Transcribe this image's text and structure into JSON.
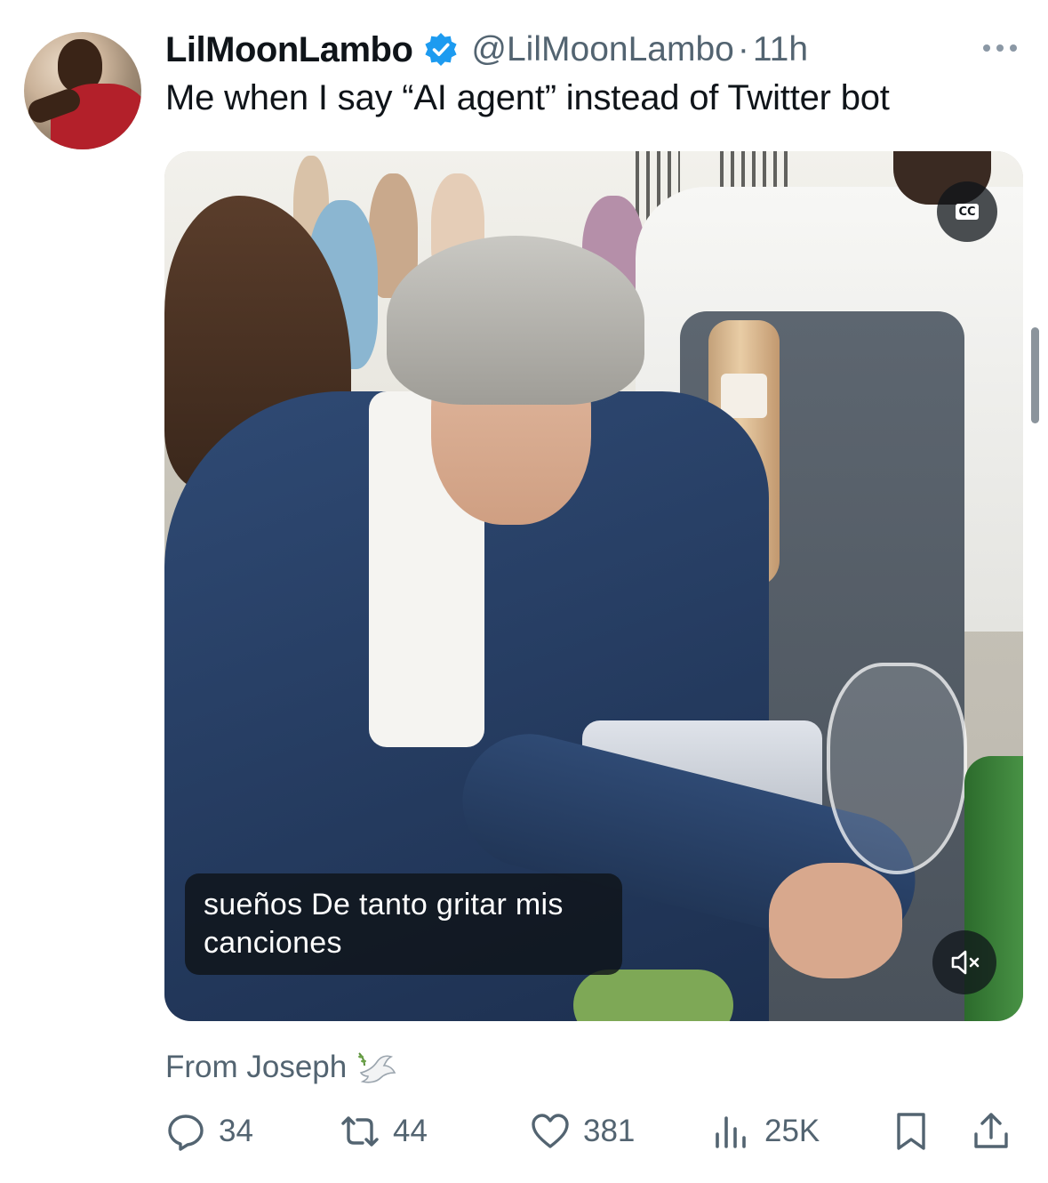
{
  "tweet": {
    "author": {
      "display_name": "LilMoonLambo",
      "handle": "@LilMoonLambo",
      "verified": true,
      "avatar_icon": "avatar-photo"
    },
    "separator": "·",
    "time": "11h",
    "text": "Me when I say “AI agent” instead of Twitter bot",
    "media": {
      "type": "video",
      "caption_text": "sueños De tanto gritar mis canciones",
      "cc_label": "CC",
      "muted": true
    },
    "source_label": "From Joseph",
    "source_icon": "dove-icon",
    "stats": {
      "replies": "34",
      "reposts": "44",
      "likes": "381",
      "views": "25K"
    }
  },
  "colors": {
    "verified_blue": "#1d9bf0",
    "secondary_text": "#536471",
    "primary_text": "#0f1419"
  }
}
